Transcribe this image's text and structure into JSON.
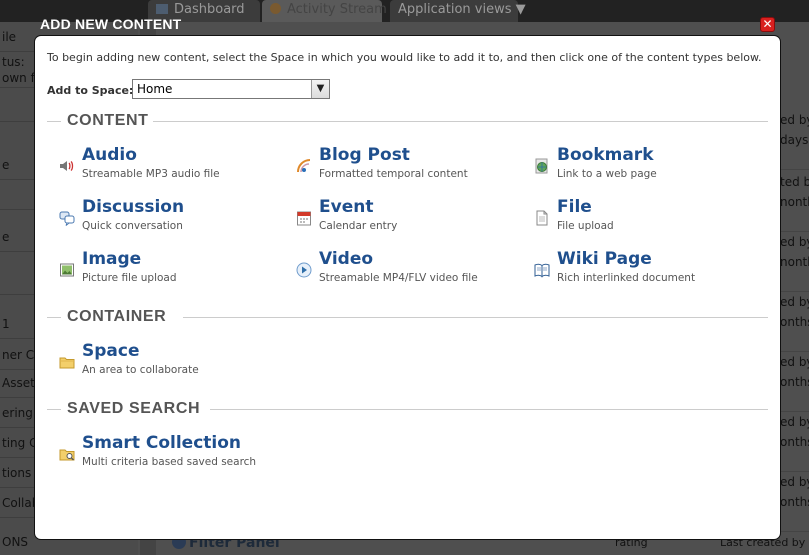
{
  "background": {
    "tabs": [
      {
        "label": "Dashboard"
      },
      {
        "label": "Activity Stream"
      },
      {
        "label": "Application views ▼"
      }
    ],
    "left_rows": [
      "ile",
      "tus:",
      "own f",
      "",
      "e",
      "",
      "e",
      "",
      "1",
      "ner Co",
      "Asset",
      "ering",
      "ting C",
      "tions",
      "Collab",
      "ONS"
    ],
    "right_rows": [
      {
        "a": "ed by",
        "b": "days"
      },
      {
        "a": "ted by",
        "b": "nonth"
      },
      {
        "a": "ed by",
        "b": "nonth"
      },
      {
        "a": "ed by",
        "b": "onths"
      },
      {
        "a": "ed by",
        "b": "onths"
      },
      {
        "a": "ed by",
        "b": "onths"
      },
      {
        "a": "ed by",
        "b": "onths"
      }
    ],
    "filter_panel": "Filter Panel",
    "rating": "rating",
    "last_created": "Last created by"
  },
  "dialog": {
    "title": "ADD NEW CONTENT",
    "close": "✕",
    "intro": "To begin adding new content, select the Space in which you would like to add it to, and then click one of the content types below.",
    "add_to_space_label": "Add to Space:",
    "space_selected": "Home",
    "sections": {
      "content": {
        "title": "CONTENT",
        "items": [
          {
            "name": "Audio",
            "desc": "Streamable MP3 audio file",
            "icon": "speaker-icon"
          },
          {
            "name": "Blog Post",
            "desc": "Formatted temporal content",
            "icon": "rss-icon"
          },
          {
            "name": "Bookmark",
            "desc": "Link to a web page",
            "icon": "globe-icon"
          },
          {
            "name": "Discussion",
            "desc": "Quick conversation",
            "icon": "speech-bubbles-icon"
          },
          {
            "name": "Event",
            "desc": "Calendar entry",
            "icon": "calendar-icon"
          },
          {
            "name": "File",
            "desc": "File upload",
            "icon": "file-icon"
          },
          {
            "name": "Image",
            "desc": "Picture file upload",
            "icon": "picture-icon"
          },
          {
            "name": "Video",
            "desc": "Streamable MP4/FLV video file",
            "icon": "play-icon"
          },
          {
            "name": "Wiki Page",
            "desc": "Rich interlinked document",
            "icon": "book-icon"
          }
        ]
      },
      "container": {
        "title": "CONTAINER",
        "items": [
          {
            "name": "Space",
            "desc": "An area to collaborate",
            "icon": "folder-icon"
          }
        ]
      },
      "saved_search": {
        "title": "SAVED SEARCH",
        "items": [
          {
            "name": "Smart Collection",
            "desc": "Multi criteria based saved search",
            "icon": "folder-search-icon"
          }
        ]
      }
    }
  }
}
